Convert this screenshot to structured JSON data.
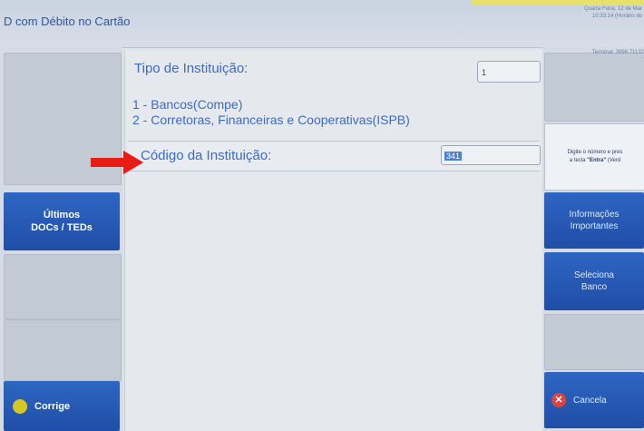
{
  "header": {
    "title": "D com Débito no Cartão",
    "date": "Quarta Feira, 12 de Mar",
    "time": "10:33:14 (Horário de",
    "terminal": "Terminal: 3998.71132"
  },
  "left_menu": {
    "history_button": "Últimos\nDOCs / TEDs",
    "correct_button": "Corrige"
  },
  "form": {
    "institution_type_label": "Tipo de Instituição:",
    "institution_type_value": "1",
    "option_1": "1 - Bancos(Compe)",
    "option_2": "2 - Corretoras, Financeiras e Cooperativas(ISPB)",
    "institution_code_label": "Código da Instituição:",
    "institution_code_value": "341"
  },
  "right_menu": {
    "hint_line1": "Digite o número e pres",
    "hint_line2_prefix": "a tecla ",
    "hint_line2_key": "\"Entra\"",
    "hint_line2_suffix": " (Verd",
    "info_button": "Informações\nImportantes",
    "select_bank_button": "Seleciona\nBanco",
    "cancel_button": "Cancela"
  },
  "colors": {
    "accent_blue": "#2a5fbe",
    "label_blue": "#3c6bc2",
    "annotation_red": "#e81c14",
    "correct_icon": "#d8c625",
    "cancel_icon": "#d9463f"
  }
}
